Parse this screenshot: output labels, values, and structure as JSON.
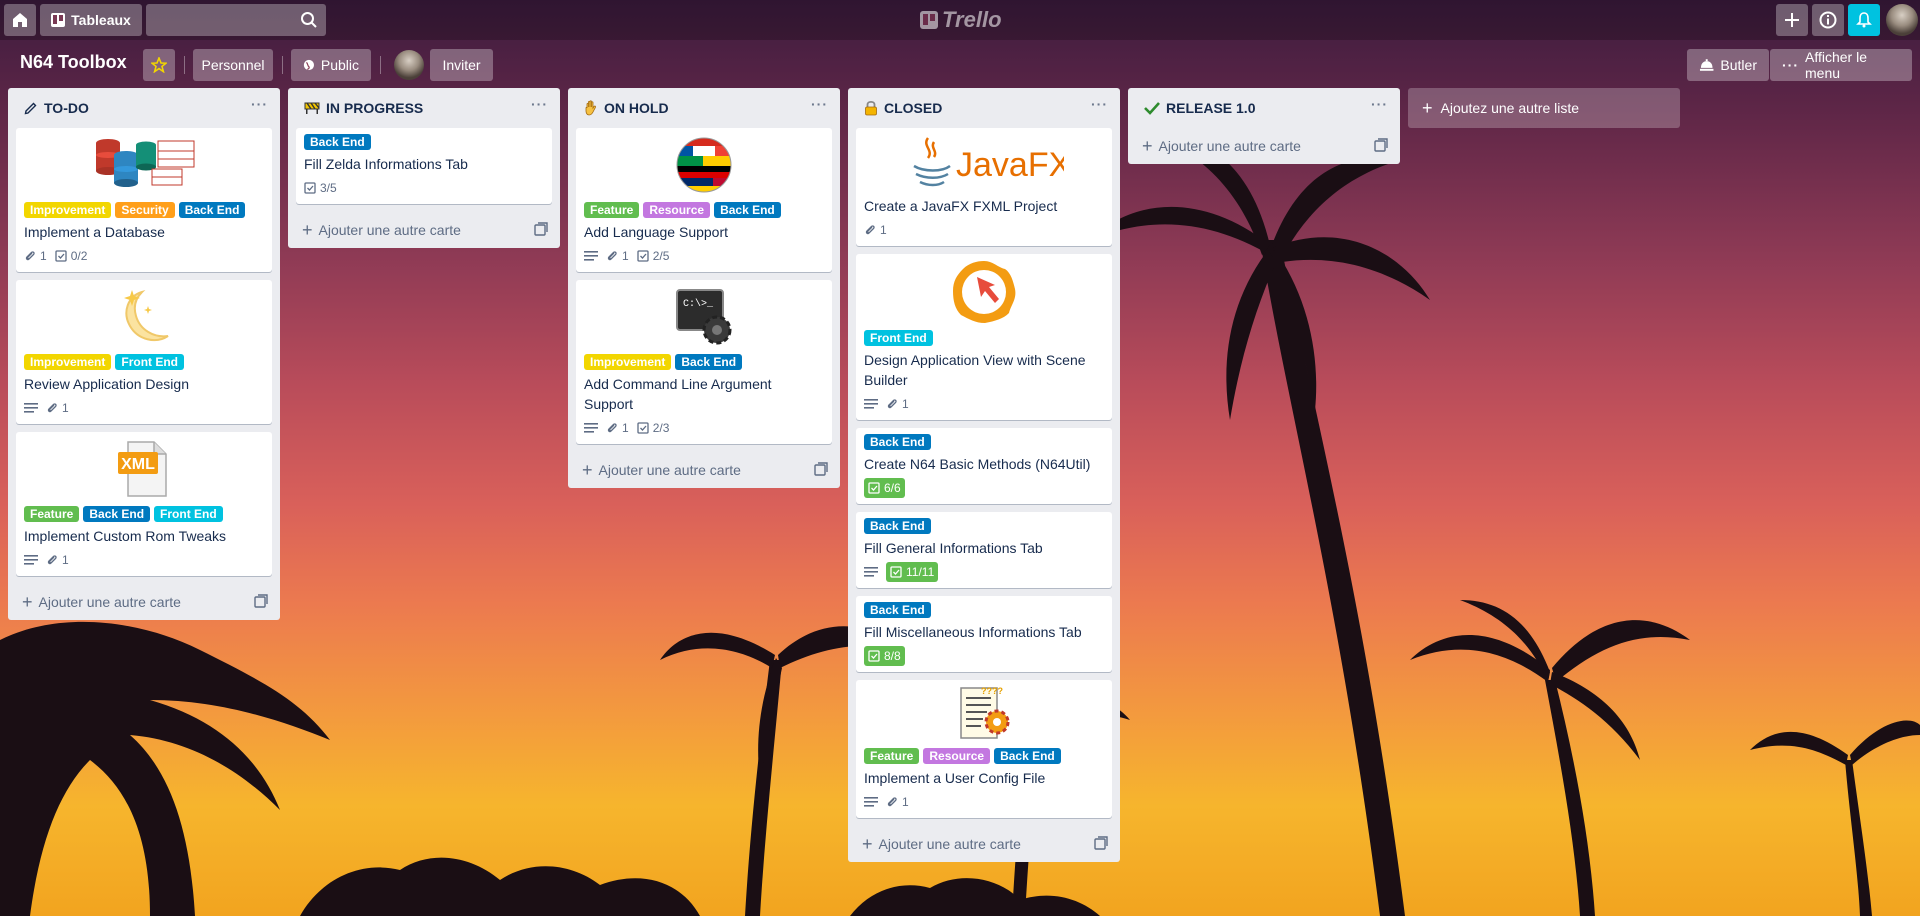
{
  "topbar": {
    "boards_label": "Tableaux",
    "search_placeholder": "",
    "logo_text": "Trello"
  },
  "board": {
    "title": "N64 Toolbox",
    "personal_label": "Personnel",
    "visibility_label": "Public",
    "invite_label": "Inviter",
    "butler_label": "Butler",
    "menu_label": "Afficher le menu"
  },
  "colors": {
    "improvement": "#f2d600",
    "security": "#ff9f1a",
    "backend": "#0079bf",
    "frontend": "#00c2e0",
    "feature": "#61bd4f",
    "resource": "#c377e0",
    "notification": "#00c2e0"
  },
  "add_card_label": "Ajouter une autre carte",
  "add_list_label": "Ajoutez une autre liste",
  "lists": [
    {
      "title": "TO-DO",
      "icon": "pencil-icon",
      "cards": [
        {
          "title": "Implement a Database",
          "cover": "database-icon",
          "labels": [
            "Improvement",
            "Security",
            "Back End"
          ],
          "attachments": "1",
          "checklist": "0/2"
        },
        {
          "title": "Review Application Design",
          "cover": "moon-icon",
          "labels": [
            "Improvement",
            "Front End"
          ],
          "attachments": "1"
        },
        {
          "title": "Implement Custom Rom Tweaks",
          "cover": "xml-file-icon",
          "cover_text": "XML",
          "labels": [
            "Feature",
            "Back End",
            "Front End"
          ],
          "attachments": "1"
        }
      ]
    },
    {
      "title": "IN PROGRESS",
      "icon": "construction-icon",
      "cards": [
        {
          "title": "Fill Zelda Informations Tab",
          "labels": [
            "Back End"
          ],
          "checklist": "3/5"
        }
      ]
    },
    {
      "title": "ON HOLD",
      "icon": "hand-icon",
      "cards": [
        {
          "title": "Add Language Support",
          "cover": "flags-globe-icon",
          "labels": [
            "Feature",
            "Resource",
            "Back End"
          ],
          "attachments": "1",
          "checklist": "2/5"
        },
        {
          "title": "Add Command Line Argument Support",
          "cover": "terminal-gear-icon",
          "cover_text": "C:\\>_",
          "labels": [
            "Improvement",
            "Back End"
          ],
          "attachments": "1",
          "checklist": "2/3"
        }
      ]
    },
    {
      "title": "CLOSED",
      "icon": "lock-icon",
      "cards": [
        {
          "title": "Create a JavaFX FXML Project",
          "cover": "javafx-logo-icon",
          "cover_text": "JavaFX",
          "attachments": "1"
        },
        {
          "title": "Design Application View with Scene Builder",
          "cover": "scene-builder-icon",
          "labels": [
            "Front End"
          ],
          "attachments": "1"
        },
        {
          "title": "Create N64 Basic Methods (N64Util)",
          "labels": [
            "Back End"
          ],
          "checklist_done": "6/6"
        },
        {
          "title": "Fill General Informations Tab",
          "labels": [
            "Back End"
          ],
          "checklist_done": "11/11"
        },
        {
          "title": "Fill Miscellaneous Informations Tab",
          "labels": [
            "Back End"
          ],
          "checklist_done": "8/8"
        },
        {
          "title": "Implement a User Config File",
          "cover": "config-file-icon",
          "labels": [
            "Feature",
            "Resource",
            "Back End"
          ],
          "attachments": "1"
        }
      ]
    },
    {
      "title": "RELEASE 1.0",
      "icon": "check-icon",
      "cards": []
    }
  ]
}
